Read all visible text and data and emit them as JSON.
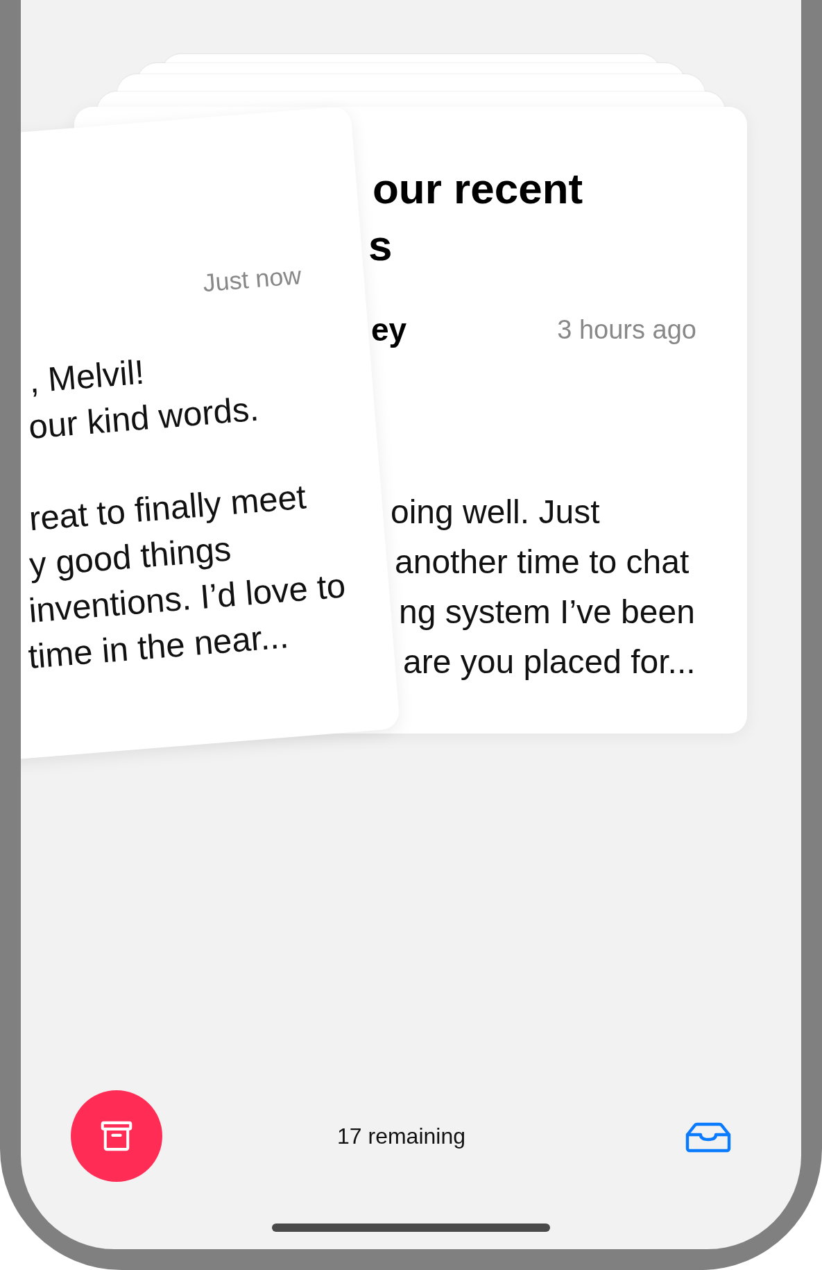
{
  "back_card": {
    "title_lines": [
      "our recent",
      "s"
    ],
    "author": "ey",
    "time": "3 hours ago",
    "body_lines": [
      "oing well. Just",
      "another time to chat",
      "ng system I’ve been",
      "are you placed for..."
    ]
  },
  "front_card": {
    "time": "Just now",
    "paragraphs": [
      [
        ", Melvil!",
        "our kind words."
      ],
      [
        "reat to finally meet",
        "y good things",
        "inventions. I’d love to",
        "time in the near..."
      ]
    ]
  },
  "toolbar": {
    "remaining": "17 remaining"
  }
}
